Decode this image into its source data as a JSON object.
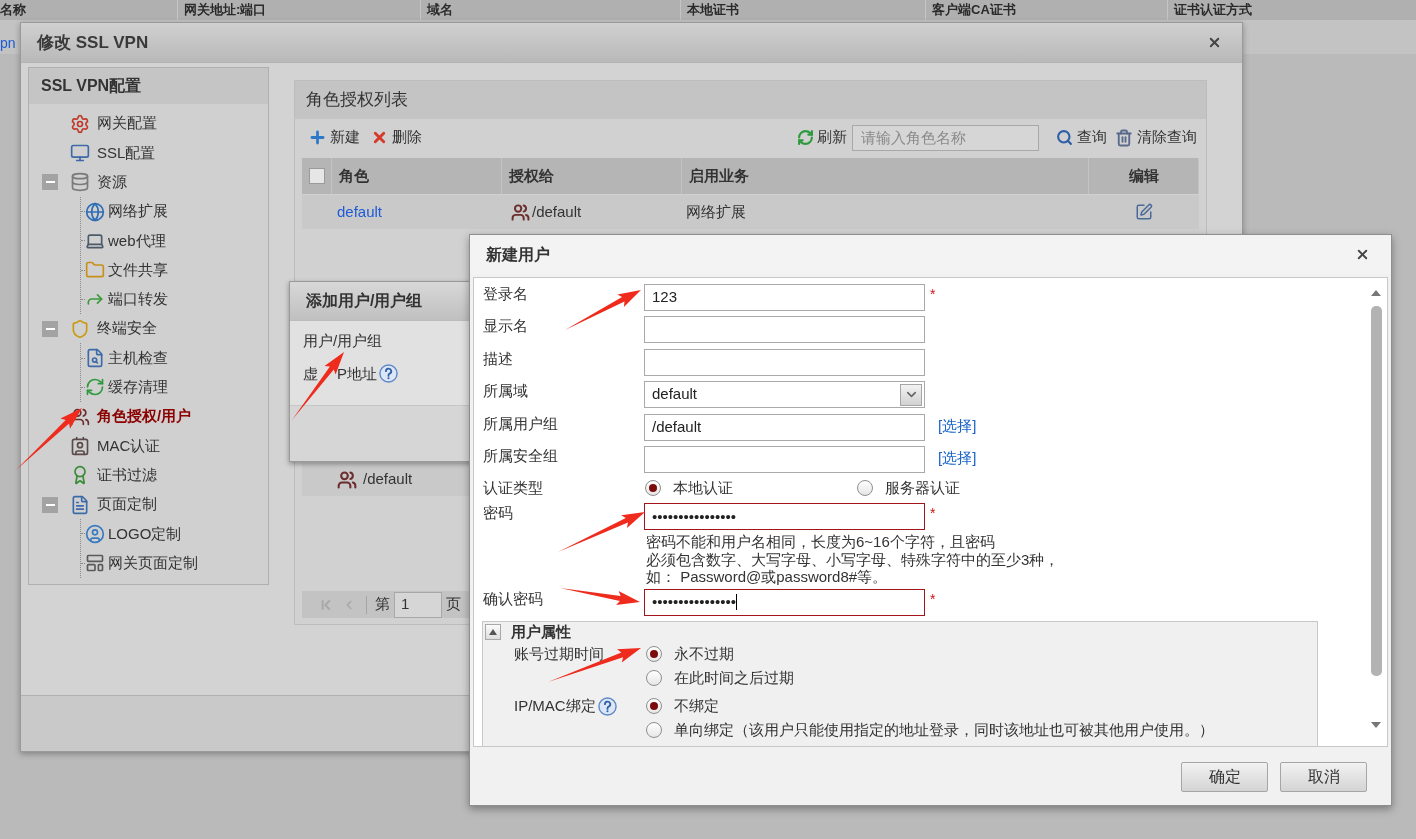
{
  "background_table": {
    "columns": [
      "名称",
      "网关地址:端口",
      "域名",
      "本地证书",
      "客户端CA证书",
      "证书认证方式"
    ],
    "first_cell": "pn"
  },
  "main_window": {
    "title": "修改 SSL VPN"
  },
  "sidebar": {
    "title": "SSL VPN配置",
    "items": [
      {
        "label": "网关配置",
        "selected": false
      },
      {
        "label": "SSL配置",
        "selected": false
      },
      {
        "label": "资源",
        "selected": false,
        "expanded": true,
        "children": [
          {
            "label": "网络扩展",
            "selected": false
          },
          {
            "label": "web代理",
            "selected": false
          },
          {
            "label": "文件共享",
            "selected": false
          },
          {
            "label": "端口转发",
            "selected": false
          }
        ]
      },
      {
        "label": "终端安全",
        "selected": false,
        "expanded": true,
        "children": [
          {
            "label": "主机检查",
            "selected": false
          },
          {
            "label": "缓存清理",
            "selected": false
          }
        ]
      },
      {
        "label": "角色授权/用户",
        "selected": true
      },
      {
        "label": "MAC认证",
        "selected": false
      },
      {
        "label": "证书过滤",
        "selected": false
      },
      {
        "label": "页面定制",
        "selected": false,
        "expanded": true,
        "children": [
          {
            "label": "LOGO定制",
            "selected": false
          },
          {
            "label": "网关页面定制",
            "selected": false
          }
        ]
      }
    ]
  },
  "role_panel": {
    "title": "角色授权列表",
    "toolbar": {
      "new": "新建",
      "delete": "删除",
      "refresh": "刷新",
      "search_placeholder": "请输入角色名称",
      "query": "查询",
      "clear_query": "清除查询"
    },
    "table": {
      "select_all_checked": false,
      "columns": [
        "角色",
        "授权给",
        "启用业务",
        "编辑"
      ],
      "rows": [
        {
          "role": "default",
          "granted_to": "/default",
          "services": "网络扩展"
        }
      ]
    },
    "member_row": {
      "name": "/default"
    },
    "pager": {
      "prefix": "第",
      "page": "1",
      "suffix": "页"
    }
  },
  "add_member_dialog": {
    "title": "添加用户/用户组",
    "fields": [
      {
        "label_fragments": [
          "用户/用户组"
        ],
        "help": false
      },
      {
        "label_fragments": [
          "虚",
          "P地址"
        ],
        "help": true
      }
    ]
  },
  "new_user_dialog": {
    "title": "新建用户",
    "fields": [
      {
        "kind": "text",
        "label": "登录名",
        "value": "123",
        "required_mark": "*",
        "invalid": false,
        "focused": false
      },
      {
        "kind": "text",
        "label": "显示名",
        "invalid": false,
        "focused": false
      },
      {
        "kind": "text",
        "label": "描述",
        "invalid": false,
        "focused": false
      },
      {
        "kind": "select",
        "label": "所属域",
        "value": "default",
        "invalid": false,
        "focused": false
      },
      {
        "kind": "text",
        "label": "所属用户组",
        "value": "/default",
        "link": "[选择]",
        "invalid": false,
        "focused": false
      },
      {
        "kind": "text",
        "label": "所属安全组",
        "link": "[选择]",
        "invalid": false,
        "focused": false
      },
      {
        "kind": "radio",
        "label": "认证类型",
        "options": [
          {
            "label": "本地认证",
            "selected": true
          },
          {
            "label": "服务器认证",
            "selected": false
          }
        ]
      },
      {
        "kind": "text",
        "label": "密码",
        "value": "••••••••••••••••",
        "required_mark": "*",
        "invalid": true,
        "focused": false,
        "hint": [
          "密码不能和用户名相同，长度为6~16个字符，且密码",
          "必须包含数字、大写字母、小写字母、特殊字符中的至少3种，",
          "如： Password@或password8#等。"
        ]
      },
      {
        "kind": "text",
        "label": "确认密码",
        "value": "••••••••••••••••",
        "required_mark": "*",
        "invalid": true,
        "focused": true
      }
    ],
    "attributes": {
      "title": "用户属性",
      "expanded": true,
      "groups": [
        {
          "label": "账号过期时间",
          "help": false,
          "options": [
            {
              "label": "永不过期",
              "selected": true
            },
            {
              "label": "在此时间之后过期",
              "selected": false
            }
          ]
        },
        {
          "label": "IP/MAC绑定",
          "help": true,
          "options": [
            {
              "label": "不绑定",
              "selected": true
            },
            {
              "label": "单向绑定（该用户只能使用指定的地址登录，同时该地址也可被其他用户使用。）",
              "selected": false
            }
          ]
        }
      ]
    },
    "buttons": [
      "确定",
      "取消"
    ]
  }
}
